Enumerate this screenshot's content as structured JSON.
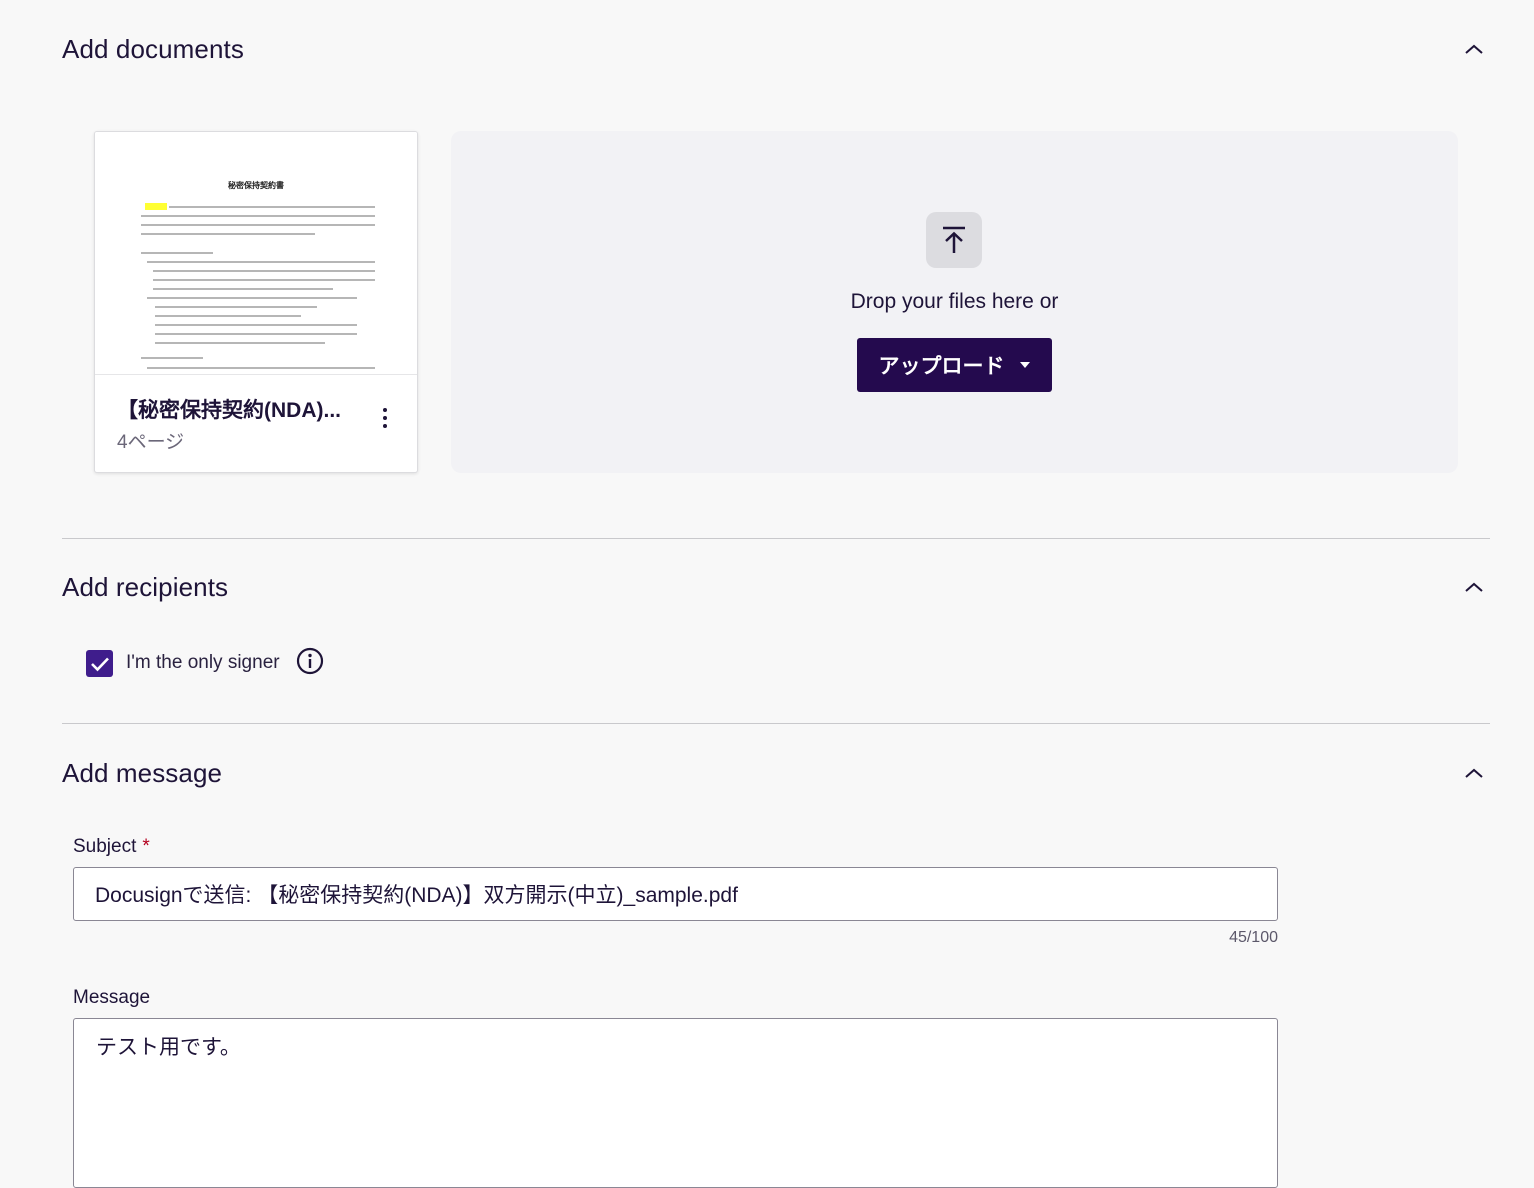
{
  "documents": {
    "title": "Add documents",
    "card": {
      "thumbnail_heading": "秘密保持契約書",
      "name": "【秘密保持契約(NDA)...",
      "pages": "4ページ"
    },
    "dropzone": {
      "text": "Drop your files here or",
      "upload_label": "アップロード"
    }
  },
  "recipients": {
    "title": "Add recipients",
    "only_signer_label": "I'm the only signer",
    "only_signer_checked": true
  },
  "message": {
    "title": "Add message",
    "subject_label": "Subject",
    "required_mark": "*",
    "subject_value": "Docusignで送信: 【秘密保持契約(NDA)】双方開示(中立)_sample.pdf",
    "subject_count": "45/100",
    "message_label": "Message",
    "message_value": "テスト用です。"
  },
  "colors": {
    "primary": "#240a4e",
    "checkbox": "#3f1d8c",
    "required": "#b3001e",
    "background": "#f8f8f8"
  }
}
